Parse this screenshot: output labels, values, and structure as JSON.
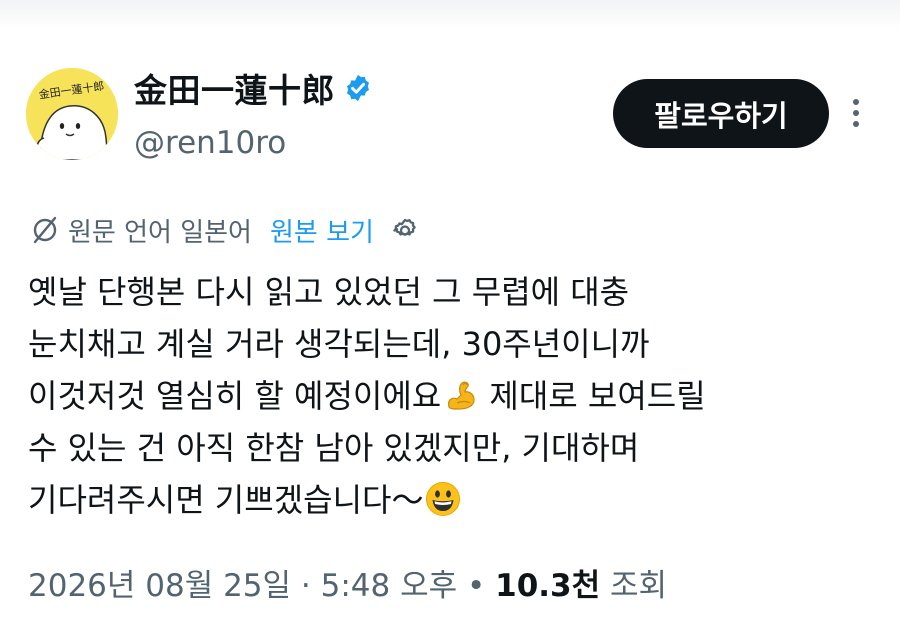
{
  "author": {
    "display_name": "金田一蓮十郎",
    "handle": "@ren10ro",
    "verified": true,
    "avatar_text": "金田一蓮十郎"
  },
  "actions": {
    "follow_label": "팔로우하기",
    "more_icon": "more-vertical-icon"
  },
  "translation": {
    "icon": "translate-icon",
    "source_text": "원문 언어 일본어",
    "show_original_label": "원본 보기",
    "settings_icon": "gear-icon"
  },
  "tweet": {
    "lines": [
      "옛날 단행본 다시 읽고 있었던 그 무렵에 대충",
      "눈치채고 계실 거라 생각되는데, 30주년이니까",
      "이것저것 열심히 할 예정이에요",
      " 제대로 보여드릴",
      "수 있는 건 아직 한참 남아 있겠지만, 기대하며",
      "기다려주시면 기쁘겠습니다～"
    ],
    "emojis": [
      "flexed-biceps-emoji",
      "grinning-face-emoji"
    ]
  },
  "meta": {
    "date": "2026년 08월 25일",
    "separator1": " · ",
    "time": "5:48 오후",
    "separator2": " • ",
    "views_count": "10.3천",
    "views_label": " 조회"
  },
  "colors": {
    "text_primary": "#0f1419",
    "text_secondary": "#536471",
    "link_blue": "#1d9bf0",
    "verified_blue": "#1d9bf0",
    "button_black": "#0f1419",
    "avatar_yellow": "#f7e35a"
  }
}
